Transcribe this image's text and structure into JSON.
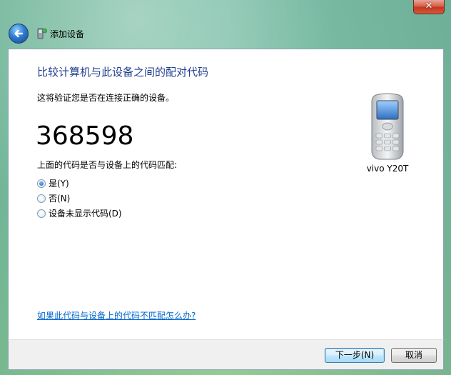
{
  "window": {
    "title": "添加设备",
    "close_label": "✕"
  },
  "main": {
    "heading": "比较计算机与此设备之间的配对代码",
    "description": "这将验证您是否在连接正确的设备。",
    "pairing_code": "368598",
    "question": "上面的代码是否与设备上的代码匹配:",
    "options": [
      {
        "label": "是(Y)",
        "checked": true
      },
      {
        "label": "否(N)",
        "checked": false
      },
      {
        "label": "设备未显示代码(D)",
        "checked": false
      }
    ],
    "help_link": "如果此代码与设备上的代码不匹配怎么办?"
  },
  "device": {
    "name": "vivo Y20T",
    "icon": "mobile-phone-icon"
  },
  "footer": {
    "next_label": "下一步(N)",
    "cancel_label": "取消"
  },
  "colors": {
    "heading": "#1f3f8f",
    "link": "#0066cc",
    "close": "#c3371d"
  }
}
